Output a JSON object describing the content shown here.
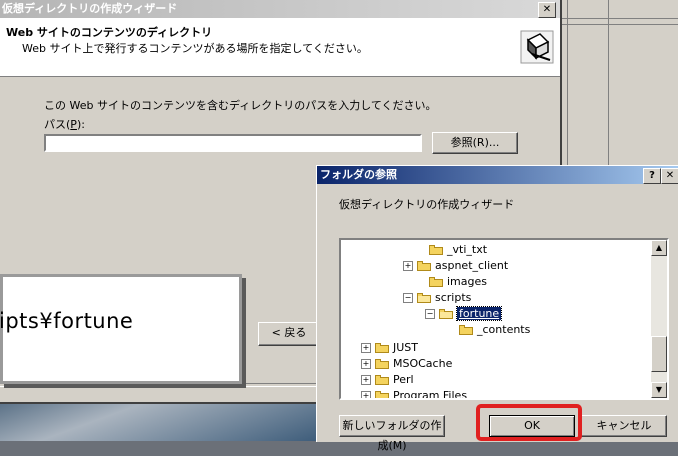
{
  "wizard": {
    "title": "仮想ディレクトリの作成ウィザード",
    "close_glyph": "✕",
    "header_title": "Web サイトのコンテンツのディレクトリ",
    "header_subtitle": "Web サイト上で発行するコンテンツがある場所を指定してください。",
    "header_icon": "wizard-book-icon",
    "instruction": "この Web サイトのコンテンツを含むディレクトリのパスを入力してください。",
    "path_label": "パス(",
    "path_label_accel": "P",
    "path_label_end": "):",
    "path_value": "",
    "browse_label": "参照(R)...",
    "back_label": "< 戻る"
  },
  "callout": {
    "text": "ipts¥fortune"
  },
  "folder_dialog": {
    "title": "フォルダの参照",
    "help_glyph": "?",
    "close_glyph": "✕",
    "subtitle": "仮想ディレクトリの作成ウィザード",
    "tree": [
      {
        "label": "_vti_txt",
        "expander": "",
        "open": false,
        "selected": false
      },
      {
        "label": "aspnet_client",
        "expander": "+",
        "open": false,
        "selected": false
      },
      {
        "label": "images",
        "expander": "",
        "open": false,
        "selected": false
      },
      {
        "label": "scripts",
        "expander": "−",
        "open": true,
        "selected": false
      },
      {
        "label": "fortune",
        "expander": "−",
        "open": true,
        "selected": true
      },
      {
        "label": "_contents",
        "expander": "",
        "open": false,
        "selected": false
      },
      {
        "label": "JUST",
        "expander": "+",
        "open": false,
        "selected": false
      },
      {
        "label": "MSOCache",
        "expander": "+",
        "open": false,
        "selected": false
      },
      {
        "label": "Perl",
        "expander": "+",
        "open": false,
        "selected": false
      },
      {
        "label": "Program Files",
        "expander": "+",
        "open": false,
        "selected": false
      }
    ],
    "scroll_up": "▲",
    "scroll_down": "▼",
    "new_folder_label": "新しいフォルダの作成(M)",
    "ok_label": "OK",
    "cancel_label": "キャンセル",
    "highlight_color": "#e02020"
  }
}
